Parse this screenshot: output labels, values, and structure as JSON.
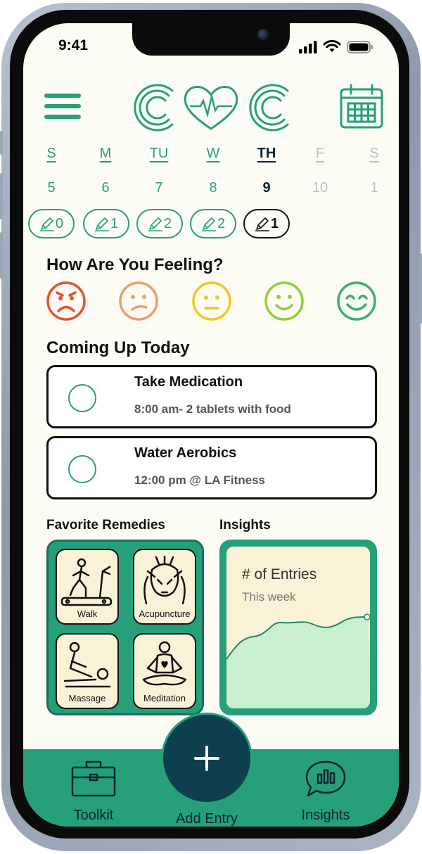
{
  "status_bar": {
    "time": "9:41"
  },
  "week": [
    {
      "label": "S",
      "date": "5",
      "state": "normal"
    },
    {
      "label": "M",
      "date": "6",
      "state": "normal"
    },
    {
      "label": "TU",
      "date": "7",
      "state": "normal"
    },
    {
      "label": "W",
      "date": "8",
      "state": "normal"
    },
    {
      "label": "TH",
      "date": "9",
      "state": "active"
    },
    {
      "label": "F",
      "date": "10",
      "state": "muted"
    },
    {
      "label": "S",
      "date": "1",
      "state": "muted"
    }
  ],
  "entry_counts": [
    "0",
    "1",
    "2",
    "2",
    "1"
  ],
  "feeling": {
    "title": "How Are You Feeling?",
    "moods": [
      {
        "icon": "very-sad-face-icon",
        "color": "#e5522b"
      },
      {
        "icon": "sad-face-icon",
        "color": "#f39a6d"
      },
      {
        "icon": "neutral-face-icon",
        "color": "#f2c624"
      },
      {
        "icon": "happy-face-icon",
        "color": "#8fcf3a"
      },
      {
        "icon": "very-happy-face-icon",
        "color": "#37b36e"
      }
    ]
  },
  "coming_up": {
    "title": "Coming Up Today",
    "tasks": [
      {
        "title": "Take Medication",
        "detail": "8:00 am- 2 tablets with food"
      },
      {
        "title": "Water Aerobics",
        "detail": "12:00 pm @ LA Fitness"
      }
    ]
  },
  "remedies": {
    "title": "Favorite Remedies",
    "items": [
      {
        "label": "Walk",
        "icon": "treadmill-icon"
      },
      {
        "label": "Acupuncture",
        "icon": "acupuncture-icon"
      },
      {
        "label": "Massage",
        "icon": "massage-icon"
      },
      {
        "label": "Meditation",
        "icon": "meditation-icon"
      }
    ]
  },
  "insights": {
    "title": "Insights",
    "card_title": "# of Entries",
    "card_subtitle": "This week"
  },
  "bottom_nav": {
    "toolkit": "Toolkit",
    "add_entry": "Add Entry",
    "insights": "Insights"
  },
  "colors": {
    "brand_green": "#25a07a",
    "dark_teal": "#0e3f4f",
    "background": "#fdfcf4",
    "tile_cream": "#f9f2d6"
  }
}
